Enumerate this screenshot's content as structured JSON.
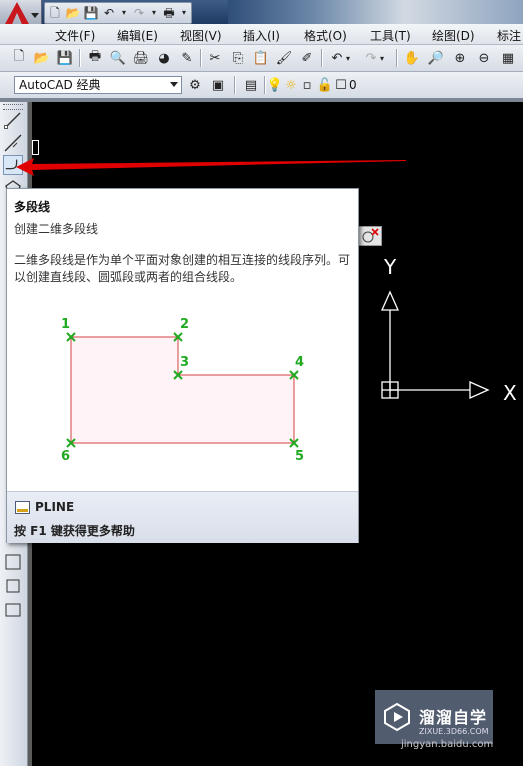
{
  "menu": [
    "文件(F)",
    "编辑(E)",
    "视图(V)",
    "插入(I)",
    "格式(O)",
    "工具(T)",
    "绘图(D)",
    "标注"
  ],
  "workspace": {
    "selected": "AutoCAD 经典"
  },
  "layer": {
    "current": "0"
  },
  "tooltip": {
    "title": "多段线",
    "subtitle": "创建二维多段线",
    "description": "二维多段线是作为单个平面对象创建的相互连接的线段序列。可以创建直线段、圆弧段或两者的组合线段。",
    "vertex_labels": [
      "1",
      "2",
      "3",
      "4",
      "5",
      "6"
    ],
    "command": "PLINE",
    "help": "按 F1 键获得更多帮助"
  },
  "ucs": {
    "y_label": "Y",
    "x_label": "X"
  },
  "watermark": {
    "title": "溜溜自学",
    "subtitle": "ZIXUE.3D66.COM",
    "footer": "jingyan.baidu.com"
  },
  "colors": {
    "title_bar": "#1e3a62",
    "accent_red": "#e00000",
    "vertex_green": "#22aa22",
    "shape_line": "#d04040",
    "canvas": "#000000"
  }
}
